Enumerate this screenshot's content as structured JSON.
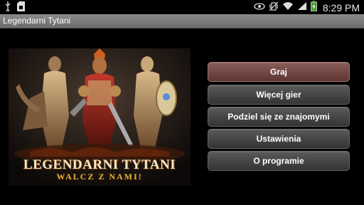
{
  "status_bar": {
    "time": "8:29 PM",
    "icons": [
      "usb-icon",
      "sd-card-icon",
      "eye-icon",
      "vibrate-icon",
      "wifi-icon",
      "signal-icon",
      "battery-charging-icon"
    ]
  },
  "app": {
    "title": "Legendarni Tytani"
  },
  "banner": {
    "logo_title": "LEGENDARNI TYTANI",
    "logo_subtitle": "WALCZ Z NAMI!"
  },
  "menu": {
    "items": [
      {
        "label": "Graj",
        "active": true
      },
      {
        "label": "Więcej gier",
        "active": false
      },
      {
        "label": "Podziel się ze znajomymi",
        "active": false
      },
      {
        "label": "Ustawienia",
        "active": false
      },
      {
        "label": "O programie",
        "active": false
      }
    ]
  },
  "colors": {
    "active_button": "#7a4f4b",
    "button": "#484848",
    "titlebar": "#7a7a7a",
    "logo_gold": "#e6b53a"
  }
}
